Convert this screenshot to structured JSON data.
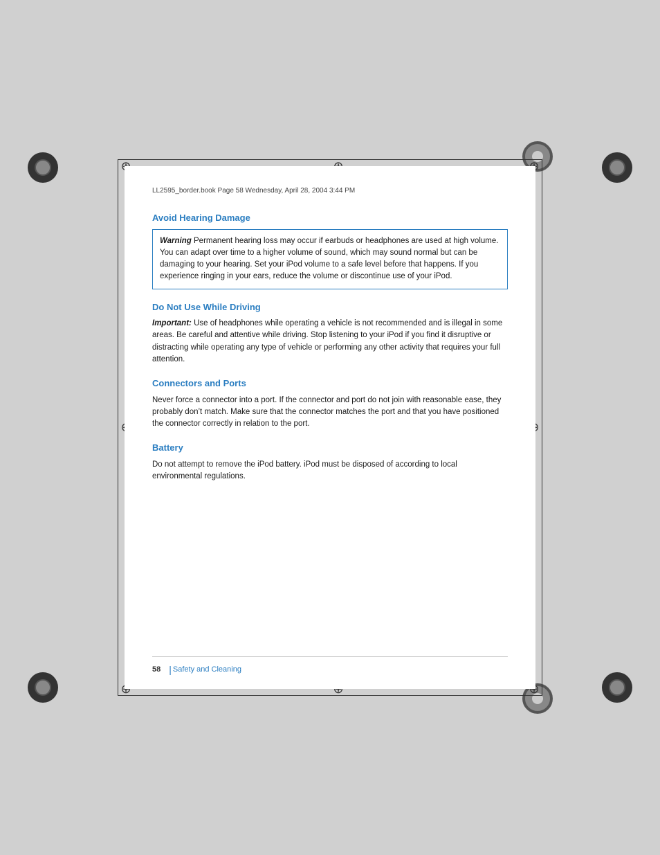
{
  "page": {
    "background_color": "#d0d0d0",
    "file_bar": "LL2595_border.book  Page 58  Wednesday, April 28, 2004  3:44 PM",
    "footer": {
      "page_number": "58",
      "separator": "|",
      "section": "Safety and Cleaning"
    }
  },
  "sections": [
    {
      "id": "avoid-hearing-damage",
      "title": "Avoid Hearing Damage",
      "has_warning_box": true,
      "warning": {
        "label": "Warning",
        "text": "Permanent hearing loss may occur if earbuds or headphones are used at high volume. You can adapt over time to a higher volume of sound, which may sound normal but can be damaging to your hearing. Set your iPod volume to a safe level before that happens. If you experience ringing in your ears, reduce the volume or discontinue use of your iPod."
      }
    },
    {
      "id": "do-not-use-while-driving",
      "title": "Do Not Use While Driving",
      "important_label": "Important:",
      "body": "Use of headphones while operating a vehicle is not recommended and is illegal in some areas. Be careful and attentive while driving. Stop listening to your iPod if you find it disruptive or distracting while operating any type of vehicle or performing any other activity that requires your full attention."
    },
    {
      "id": "connectors-and-ports",
      "title": "Connectors and Ports",
      "body": "Never force a connector into a port. If the connector and port do not join with reasonable ease, they probably don’t match. Make sure that the connector matches the port and that you have positioned the connector correctly in relation to the port."
    },
    {
      "id": "battery",
      "title": "Battery",
      "body": "Do not attempt to remove the iPod battery. iPod must be disposed of according to local environmental regulations."
    }
  ]
}
